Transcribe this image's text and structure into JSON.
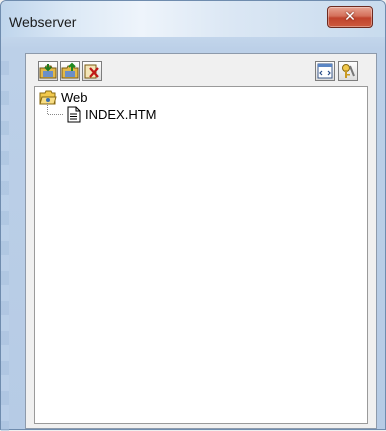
{
  "window": {
    "title": "Webserver",
    "close_glyph": "✕"
  },
  "toolbar": {
    "left_buttons": [
      {
        "name": "folder-download-icon"
      },
      {
        "name": "folder-upload-icon"
      },
      {
        "name": "delete-icon"
      }
    ],
    "right_buttons": [
      {
        "name": "html-page-icon"
      },
      {
        "name": "tools-key-icon"
      }
    ]
  },
  "tree": {
    "root": {
      "label": "Web",
      "icon": "folder-open-icon"
    },
    "children": [
      {
        "label": "INDEX.HTM",
        "icon": "document-icon"
      }
    ]
  },
  "colors": {
    "title_bar_light": "#eef4fb",
    "close_red": "#c0432c",
    "folder_yellow": "#f2c94c"
  }
}
